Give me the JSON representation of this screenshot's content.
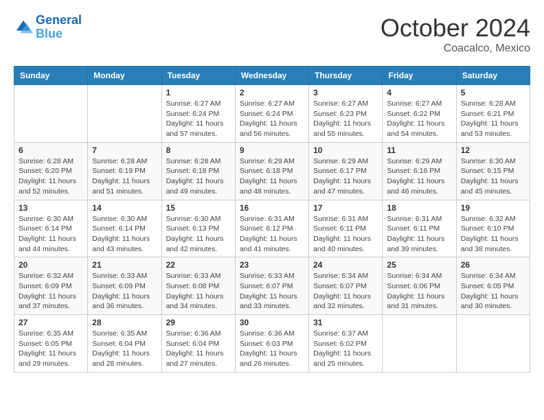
{
  "header": {
    "logo_line1": "General",
    "logo_line2": "Blue",
    "month": "October 2024",
    "location": "Coacalco, Mexico"
  },
  "weekdays": [
    "Sunday",
    "Monday",
    "Tuesday",
    "Wednesday",
    "Thursday",
    "Friday",
    "Saturday"
  ],
  "weeks": [
    [
      {
        "day": null
      },
      {
        "day": null
      },
      {
        "day": "1",
        "sunrise": "6:27 AM",
        "sunset": "6:24 PM",
        "daylight": "11 hours and 57 minutes."
      },
      {
        "day": "2",
        "sunrise": "6:27 AM",
        "sunset": "6:24 PM",
        "daylight": "11 hours and 56 minutes."
      },
      {
        "day": "3",
        "sunrise": "6:27 AM",
        "sunset": "6:23 PM",
        "daylight": "11 hours and 55 minutes."
      },
      {
        "day": "4",
        "sunrise": "6:27 AM",
        "sunset": "6:22 PM",
        "daylight": "11 hours and 54 minutes."
      },
      {
        "day": "5",
        "sunrise": "6:28 AM",
        "sunset": "6:21 PM",
        "daylight": "11 hours and 53 minutes."
      }
    ],
    [
      {
        "day": "6",
        "sunrise": "6:28 AM",
        "sunset": "6:20 PM",
        "daylight": "11 hours and 52 minutes."
      },
      {
        "day": "7",
        "sunrise": "6:28 AM",
        "sunset": "6:19 PM",
        "daylight": "11 hours and 51 minutes."
      },
      {
        "day": "8",
        "sunrise": "6:28 AM",
        "sunset": "6:18 PM",
        "daylight": "11 hours and 49 minutes."
      },
      {
        "day": "9",
        "sunrise": "6:29 AM",
        "sunset": "6:18 PM",
        "daylight": "11 hours and 48 minutes."
      },
      {
        "day": "10",
        "sunrise": "6:29 AM",
        "sunset": "6:17 PM",
        "daylight": "11 hours and 47 minutes."
      },
      {
        "day": "11",
        "sunrise": "6:29 AM",
        "sunset": "6:16 PM",
        "daylight": "11 hours and 46 minutes."
      },
      {
        "day": "12",
        "sunrise": "6:30 AM",
        "sunset": "6:15 PM",
        "daylight": "11 hours and 45 minutes."
      }
    ],
    [
      {
        "day": "13",
        "sunrise": "6:30 AM",
        "sunset": "6:14 PM",
        "daylight": "11 hours and 44 minutes."
      },
      {
        "day": "14",
        "sunrise": "6:30 AM",
        "sunset": "6:14 PM",
        "daylight": "11 hours and 43 minutes."
      },
      {
        "day": "15",
        "sunrise": "6:30 AM",
        "sunset": "6:13 PM",
        "daylight": "11 hours and 42 minutes."
      },
      {
        "day": "16",
        "sunrise": "6:31 AM",
        "sunset": "6:12 PM",
        "daylight": "11 hours and 41 minutes."
      },
      {
        "day": "17",
        "sunrise": "6:31 AM",
        "sunset": "6:11 PM",
        "daylight": "11 hours and 40 minutes."
      },
      {
        "day": "18",
        "sunrise": "6:31 AM",
        "sunset": "6:11 PM",
        "daylight": "11 hours and 39 minutes."
      },
      {
        "day": "19",
        "sunrise": "6:32 AM",
        "sunset": "6:10 PM",
        "daylight": "11 hours and 38 minutes."
      }
    ],
    [
      {
        "day": "20",
        "sunrise": "6:32 AM",
        "sunset": "6:09 PM",
        "daylight": "11 hours and 37 minutes."
      },
      {
        "day": "21",
        "sunrise": "6:33 AM",
        "sunset": "6:09 PM",
        "daylight": "11 hours and 36 minutes."
      },
      {
        "day": "22",
        "sunrise": "6:33 AM",
        "sunset": "6:08 PM",
        "daylight": "11 hours and 34 minutes."
      },
      {
        "day": "23",
        "sunrise": "6:33 AM",
        "sunset": "6:07 PM",
        "daylight": "11 hours and 33 minutes."
      },
      {
        "day": "24",
        "sunrise": "6:34 AM",
        "sunset": "6:07 PM",
        "daylight": "11 hours and 32 minutes."
      },
      {
        "day": "25",
        "sunrise": "6:34 AM",
        "sunset": "6:06 PM",
        "daylight": "11 hours and 31 minutes."
      },
      {
        "day": "26",
        "sunrise": "6:34 AM",
        "sunset": "6:05 PM",
        "daylight": "11 hours and 30 minutes."
      }
    ],
    [
      {
        "day": "27",
        "sunrise": "6:35 AM",
        "sunset": "6:05 PM",
        "daylight": "11 hours and 29 minutes."
      },
      {
        "day": "28",
        "sunrise": "6:35 AM",
        "sunset": "6:04 PM",
        "daylight": "11 hours and 28 minutes."
      },
      {
        "day": "29",
        "sunrise": "6:36 AM",
        "sunset": "6:04 PM",
        "daylight": "11 hours and 27 minutes."
      },
      {
        "day": "30",
        "sunrise": "6:36 AM",
        "sunset": "6:03 PM",
        "daylight": "11 hours and 26 minutes."
      },
      {
        "day": "31",
        "sunrise": "6:37 AM",
        "sunset": "6:02 PM",
        "daylight": "11 hours and 25 minutes."
      },
      {
        "day": null
      },
      {
        "day": null
      }
    ]
  ],
  "labels": {
    "sunrise": "Sunrise:",
    "sunset": "Sunset:",
    "daylight": "Daylight:"
  }
}
